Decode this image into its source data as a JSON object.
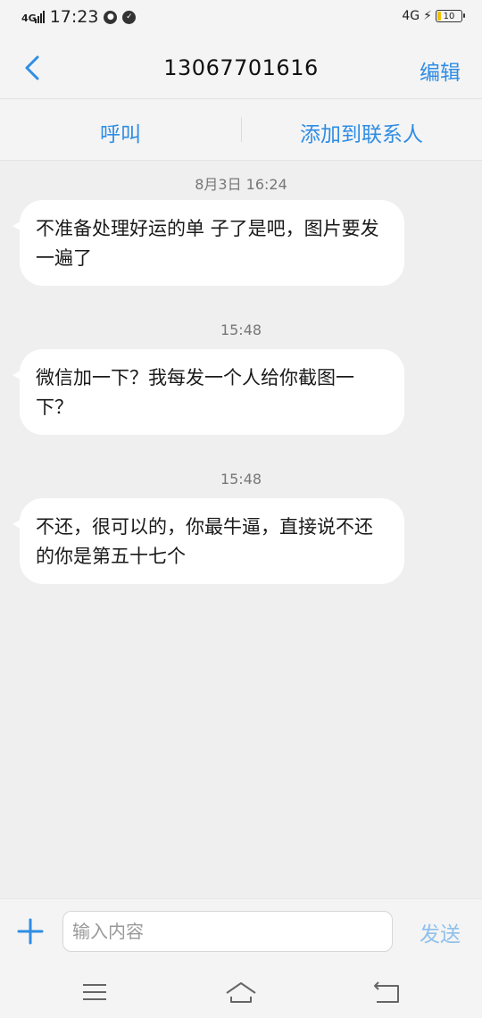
{
  "status_bar": {
    "left_network": "4G",
    "time": "17:23",
    "right_network": "4G",
    "battery_level": "10"
  },
  "header": {
    "title": "13067701616",
    "edit_label": "编辑"
  },
  "actions": {
    "call_label": "呼叫",
    "add_contact_label": "添加到联系人"
  },
  "messages": [
    {
      "timestamp": "8月3日 16:24",
      "text": "不准备处理好运的单 子了是吧，图片要发一遍了"
    },
    {
      "timestamp": "15:48",
      "text": "微信加一下？我每发一个人给你截图一下？"
    },
    {
      "timestamp": "15:48",
      "text": "不还，很可以的，你最牛逼，直接说不还的你是第五十七个"
    }
  ],
  "composer": {
    "placeholder": "输入内容",
    "value": "",
    "send_label": "发送"
  },
  "colors": {
    "accent": "#2f8de4",
    "send_disabled": "#8fc0ec",
    "background": "#efefef",
    "bubble": "#ffffff"
  },
  "icons": {
    "back": "chevron-left-icon",
    "plus": "plus-icon",
    "nav_menu": "menu-icon",
    "nav_home": "home-icon",
    "nav_back": "back-icon"
  }
}
